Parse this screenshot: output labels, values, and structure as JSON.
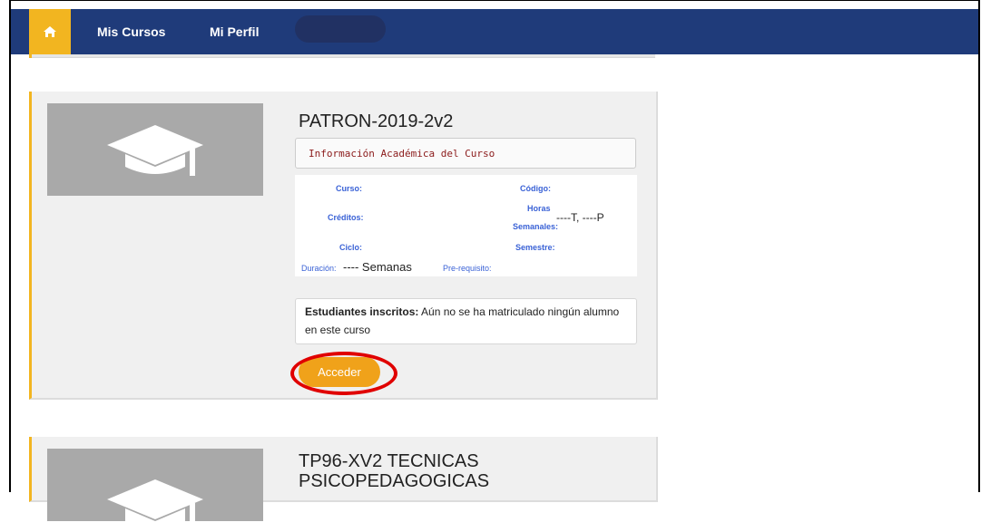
{
  "navbar": {
    "home_icon": "home-icon",
    "links": [
      "Mis Cursos",
      "Mi Perfil"
    ]
  },
  "courses": [
    {
      "title": "PATRON-2019-2v2",
      "info_header": "Información Académica del Curso",
      "fields": {
        "curso_label": "Curso:",
        "codigo_label": "Código:",
        "creditos_label": "Créditos:",
        "horas_label_1": "Horas",
        "horas_label_2": "Semanales:",
        "horas_value": "----T, ----P",
        "ciclo_label": "Ciclo:",
        "semestre_label": "Semestre:",
        "duracion_label": "Duración:",
        "duracion_value": "---- Semanas",
        "prerequisito_label": "Pre-requisito:"
      },
      "students_label": "Estudiantes inscritos:",
      "students_text": "Aún no se ha matriculado ningún alumno en este curso",
      "access_button": "Acceder"
    },
    {
      "title": "TP96-XV2 TECNICAS PSICOPEDAGOGICAS"
    }
  ],
  "colors": {
    "navbar": "#1f3b7a",
    "accent": "#f2b520",
    "button": "#f0a21a",
    "highlight": "#e00000"
  }
}
